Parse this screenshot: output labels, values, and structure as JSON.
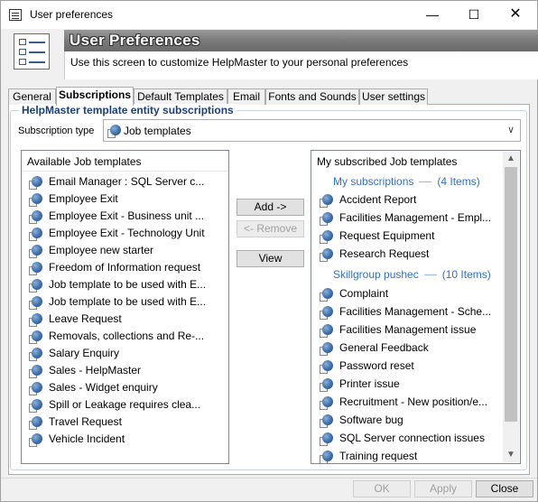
{
  "window": {
    "title": "User preferences",
    "controls": {
      "minimize": "—",
      "maximize": "☐",
      "close": "✕"
    }
  },
  "banner": {
    "heading": "User Preferences",
    "subtitle": "Use this screen to customize HelpMaster to your personal preferences"
  },
  "tabs": [
    {
      "label": "General",
      "active": false
    },
    {
      "label": "Subscriptions",
      "active": true
    },
    {
      "label": "Default Templates",
      "active": false
    },
    {
      "label": "Email",
      "active": false
    },
    {
      "label": "Fonts and Sounds",
      "active": false
    },
    {
      "label": "User settings",
      "active": false
    }
  ],
  "subscriptions": {
    "group_title": "HelpMaster template entity subscriptions",
    "type_label": "Subscription type",
    "type_value": "Job templates",
    "available": {
      "header": "Available Job templates",
      "items": [
        "Email Manager : SQL Server c...",
        "Employee Exit",
        "Employee Exit - Business unit ...",
        "Employee Exit - Technology Unit",
        "Employee new starter",
        "Freedom of Information request",
        "Job template to be used with E...",
        "Job template to be used with E...",
        "Leave Request",
        "Removals, collections and Re-...",
        "Salary Enquiry",
        "Sales - HelpMaster",
        "Sales - Widget enquiry",
        "Spill or Leakage requires clea...",
        "Travel Request",
        "Vehicle Incident"
      ]
    },
    "buttons": {
      "add": "Add ->",
      "remove": "<- Remove",
      "view": "View"
    },
    "subscribed": {
      "header": "My subscribed Job templates",
      "group1": {
        "label": "My subscriptions",
        "count": "(4 Items)"
      },
      "group1_items": [
        "Accident Report",
        "Facilities Management - Empl...",
        "Request Equipment",
        "Research Request"
      ],
      "group2": {
        "label": "Skillgroup pushec",
        "count": "(10 Items)"
      },
      "group2_items": [
        "Complaint",
        "Facilities Management - Sche...",
        "Facilities Management issue",
        "General Feedback",
        "Password reset",
        "Printer issue",
        "Recruitment - New position/e...",
        "Software bug",
        "SQL Server connection issues",
        "Training request"
      ]
    }
  },
  "footer": {
    "ok": "OK",
    "apply": "Apply",
    "close": "Close"
  },
  "colors": {
    "group_title": "#1a3f7a",
    "group_header": "#2f6fd0",
    "banner_gray": "#7a7a7a"
  }
}
